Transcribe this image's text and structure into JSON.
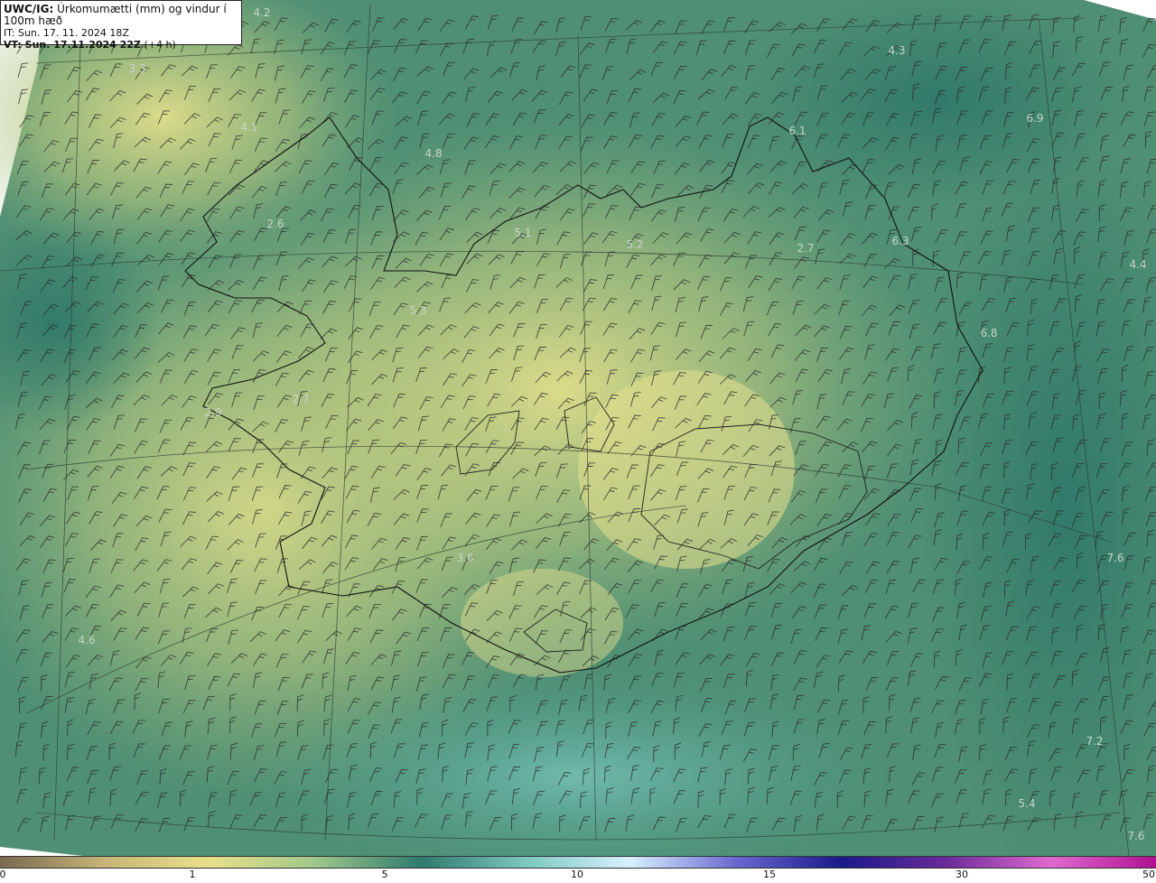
{
  "header": {
    "product": "UWC/IG:",
    "description": "Úrkomumætti (mm) og vindur í 100m hæð",
    "issue_time": "IT: Sun. 17. 11. 2024 18Z",
    "valid_label": "VT: Sun. 17.11.2024 22Z",
    "valid_offset": "(+4 h)"
  },
  "map_values": [
    {
      "text": "4.2"
    },
    {
      "text": "3.3"
    },
    {
      "text": "4.1"
    },
    {
      "text": "4.8"
    },
    {
      "text": "2.6"
    },
    {
      "text": "5.1"
    },
    {
      "text": "5.2"
    },
    {
      "text": "5.3"
    },
    {
      "text": "4.3"
    },
    {
      "text": "6.1"
    },
    {
      "text": "6.9"
    },
    {
      "text": "2.7"
    },
    {
      "text": "6.3"
    },
    {
      "text": "4.4"
    },
    {
      "text": "6.8"
    },
    {
      "text": "2.7"
    },
    {
      "text": "2.9"
    },
    {
      "text": "3.6"
    },
    {
      "text": "4.6"
    },
    {
      "text": "7.6"
    },
    {
      "text": "7.2"
    },
    {
      "text": "5.4"
    },
    {
      "text": "7.6"
    }
  ],
  "colorbar": {
    "unit": "mm",
    "ticks": [
      "0",
      "1",
      "5",
      "10",
      "15",
      "30",
      "50"
    ],
    "colors": [
      "#7a6a50",
      "#c8b577",
      "#e8e08a",
      "#9fc78a",
      "#2f7a6e",
      "#7cc7bf",
      "#d8f0ff",
      "#6a6ad0",
      "#1a1a8a",
      "#6a2a9a",
      "#e06ad0",
      "#b01090"
    ]
  }
}
